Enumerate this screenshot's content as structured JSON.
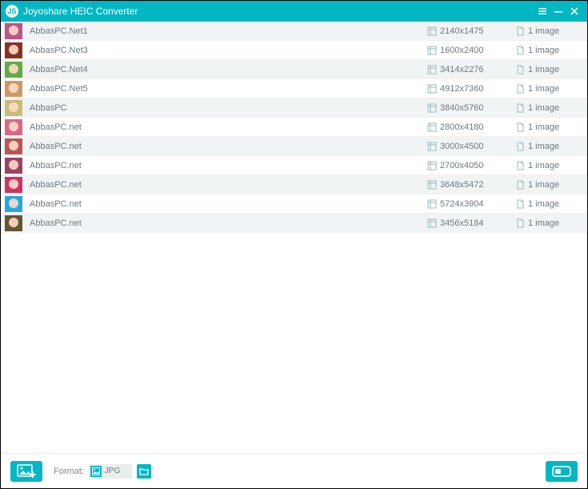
{
  "app": {
    "title": "Joyoshare HEIC Converter"
  },
  "files": [
    {
      "name": "AbbasPC.Net1",
      "dims": "2140x1475",
      "count": "1 image",
      "tc": "#b58"
    },
    {
      "name": "AbbasPC.Net3",
      "dims": "1600x2400",
      "count": "1 image",
      "tc": "#832"
    },
    {
      "name": "AbbasPC.Net4",
      "dims": "3414x2276",
      "count": "1 image",
      "tc": "#6a4"
    },
    {
      "name": "AbbasPC.Net5",
      "dims": "4912x7360",
      "count": "1 image",
      "tc": "#c96"
    },
    {
      "name": "AbbasPC",
      "dims": "3840x5760",
      "count": "1 image",
      "tc": "#cb7"
    },
    {
      "name": "AbbasPC.net",
      "dims": "2800x4180",
      "count": "1 image",
      "tc": "#d68"
    },
    {
      "name": "AbbasPC.net",
      "dims": "3000x4500",
      "count": "1 image",
      "tc": "#b55"
    },
    {
      "name": "AbbasPC.net",
      "dims": "2700x4050",
      "count": "1 image",
      "tc": "#946"
    },
    {
      "name": "AbbasPC.net",
      "dims": "3648x5472",
      "count": "1 image",
      "tc": "#c36"
    },
    {
      "name": "AbbasPC.net",
      "dims": "5724x3904",
      "count": "1 image",
      "tc": "#2ad"
    },
    {
      "name": "AbbasPC.net",
      "dims": "3456x5184",
      "count": "1 image",
      "tc": "#653"
    }
  ],
  "bottom": {
    "format_label": "Format:",
    "format_value": "JPG"
  }
}
